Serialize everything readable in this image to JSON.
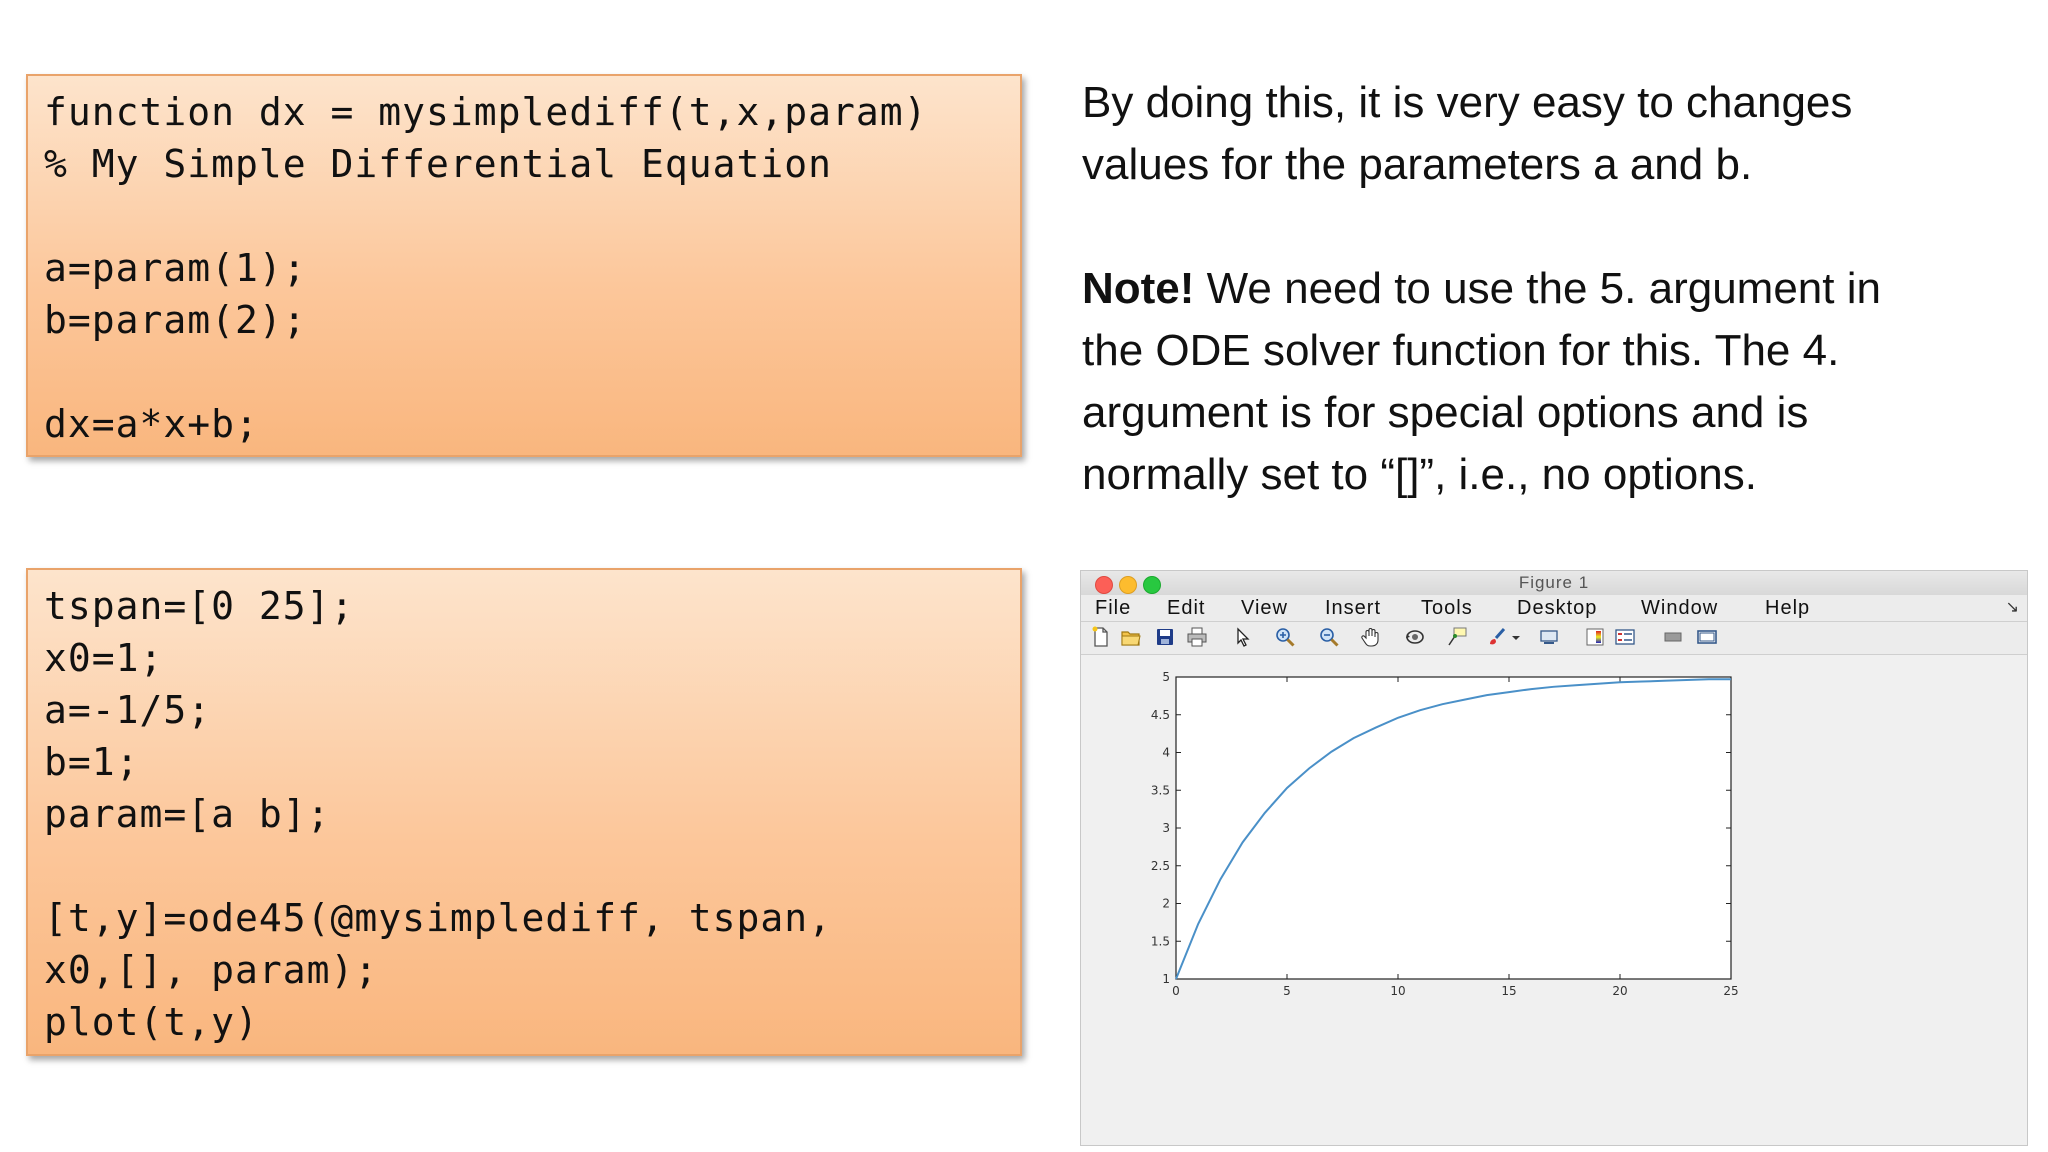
{
  "code_block_1": {
    "lines": [
      "function dx = mysimplediff(t,x,param)",
      "% My Simple Differential Equation",
      "",
      "a=param(1);",
      "b=param(2);",
      "",
      "dx=a*x+b;"
    ]
  },
  "code_block_2": {
    "lines": [
      "tspan=[0 25];",
      "x0=1;",
      "a=-1/5;",
      "b=1;",
      "param=[a b];",
      "",
      "[t,y]=ode45(@mysimplediff, tspan,",
      "x0,[], param);",
      "plot(t,y)"
    ]
  },
  "explanation": {
    "para1_line1": "By doing this, it is very easy to changes",
    "para1_line2": "values for the parameters a and b.",
    "note_label": "Note!",
    "para2_line1_rest": " We need to use the 5. argument in",
    "para2_line2": "the ODE solver function for this. The 4.",
    "para2_line3": "argument is for special options and is",
    "para2_line4": "normally set to “[]”, i.e., no options."
  },
  "figure_window": {
    "title": "Figure 1",
    "menu": [
      "File",
      "Edit",
      "View",
      "Insert",
      "Tools",
      "Desktop",
      "Window",
      "Help"
    ],
    "toolbar_icons": [
      "new-figure-icon",
      "open-file-icon",
      "save-icon",
      "print-icon",
      "pointer-icon",
      "zoom-in-icon",
      "zoom-out-icon",
      "pan-hand-icon",
      "rotate-3d-icon",
      "data-cursor-icon",
      "brush-icon",
      "brush-dropdown-icon",
      "link-plot-icon",
      "colorbar-icon",
      "legend-icon",
      "hide-plot-tools-icon",
      "show-plot-tools-icon"
    ]
  },
  "chart_data": {
    "type": "line",
    "xlim": [
      0,
      25
    ],
    "ylim": [
      1,
      5
    ],
    "x_ticks": [
      "0",
      "5",
      "10",
      "15",
      "20",
      "25"
    ],
    "y_ticks": [
      "1",
      "1.5",
      "2",
      "2.5",
      "3",
      "3.5",
      "4",
      "4.5",
      "5"
    ],
    "series": [
      {
        "color": "#4a90c8",
        "x": [
          0,
          1,
          2,
          3,
          4,
          5,
          6,
          7,
          8,
          9,
          10,
          11,
          12,
          13,
          14,
          15,
          16,
          17,
          18,
          19,
          20,
          21,
          22,
          23,
          24,
          25
        ],
        "y": [
          1.0,
          1.73,
          2.32,
          2.81,
          3.2,
          3.53,
          3.79,
          4.01,
          4.19,
          4.33,
          4.46,
          4.56,
          4.64,
          4.7,
          4.76,
          4.8,
          4.84,
          4.87,
          4.89,
          4.91,
          4.93,
          4.94,
          4.95,
          4.96,
          4.97,
          4.97
        ]
      }
    ],
    "grid": false,
    "legend": "none"
  }
}
